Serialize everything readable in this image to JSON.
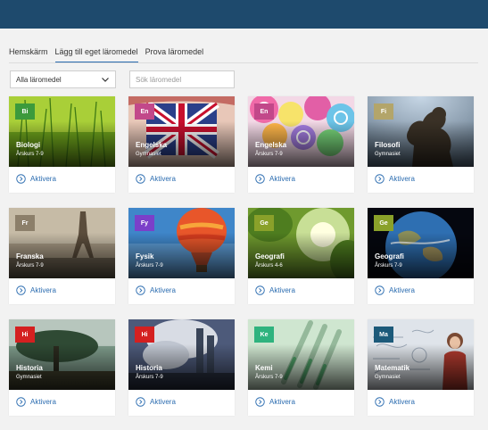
{
  "tabs": [
    {
      "label": "Hemskärm",
      "active": false
    },
    {
      "label": "Lägg till eget läromedel",
      "active": true
    },
    {
      "label": "Prova läromedel",
      "active": false
    }
  ],
  "filter": {
    "selected": "Alla läromedel"
  },
  "search": {
    "placeholder": "Sök läromedel"
  },
  "activate_label": "Aktivera",
  "cards": [
    {
      "badge": "Bi",
      "badge_color": "#3c9a3c",
      "title": "Biologi",
      "subtitle": "Årskurs 7-9",
      "image": "green-grass"
    },
    {
      "badge": "En",
      "badge_color": "#c2488a",
      "title": "Engelska",
      "subtitle": "Gymnasiet",
      "image": "union-jack-tongue"
    },
    {
      "badge": "En",
      "badge_color": "#c2488a",
      "title": "Engelska",
      "subtitle": "Årskurs 7-9",
      "image": "lollipops"
    },
    {
      "badge": "Fi",
      "badge_color": "#b3a56a",
      "title": "Filosofi",
      "subtitle": "Gymnasiet",
      "image": "thinker-statue"
    },
    {
      "badge": "Fr",
      "badge_color": "#8c7f6a",
      "title": "Franska",
      "subtitle": "Årskurs 7-9",
      "image": "eiffel-tower"
    },
    {
      "badge": "Fy",
      "badge_color": "#7b3fc9",
      "title": "Fysik",
      "subtitle": "Årskurs 7-9",
      "image": "hot-air-balloon"
    },
    {
      "badge": "Ge",
      "badge_color": "#8aa12a",
      "title": "Geografi",
      "subtitle": "Årskurs 4-6",
      "image": "forest-light"
    },
    {
      "badge": "Ge",
      "badge_color": "#8aa12a",
      "title": "Geografi",
      "subtitle": "Årskurs 7-9",
      "image": "earth-globe"
    },
    {
      "badge": "Hi",
      "badge_color": "#d42020",
      "title": "Historia",
      "subtitle": "Gymnasiet",
      "image": "tree-landscape"
    },
    {
      "badge": "Hi",
      "badge_color": "#d42020",
      "title": "Historia",
      "subtitle": "Årskurs 7-9",
      "image": "smoke-city"
    },
    {
      "badge": "Ke",
      "badge_color": "#2fb37e",
      "title": "Kemi",
      "subtitle": "Årskurs 7-9",
      "image": "test-tubes"
    },
    {
      "badge": "Ma",
      "badge_color": "#1c5a7a",
      "title": "Matematik",
      "subtitle": "Gymnasiet",
      "image": "chalkboard-formulas"
    }
  ],
  "colors": {
    "topbar": "#1e4a6d",
    "accent": "#2b6cb0",
    "background": "#f2f2f2"
  },
  "icons": {
    "filter_toggle": "chevron-down-icon",
    "activate": "chevron-right-circle-icon"
  }
}
